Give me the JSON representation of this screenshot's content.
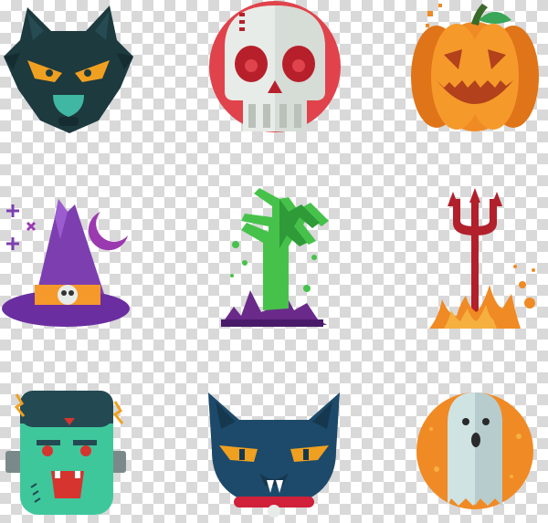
{
  "background": {
    "type": "transparency-checkerboard",
    "light": "#ffffff",
    "dark": "#d9d9d9"
  },
  "icons": [
    {
      "name": "werewolf-icon",
      "row": 1,
      "col": 1,
      "colors": [
        "#1d3a3f",
        "#f0a020",
        "#3fb7a2"
      ]
    },
    {
      "name": "skull-icon",
      "row": 1,
      "col": 2,
      "colors": [
        "#e0434b",
        "#e8ece8",
        "#b7202b"
      ]
    },
    {
      "name": "jack-o-lantern-icon",
      "row": 1,
      "col": 3,
      "colors": [
        "#f08a24",
        "#b2411c",
        "#3aa657"
      ]
    },
    {
      "name": "witch-hat-icon",
      "row": 2,
      "col": 1,
      "colors": [
        "#7d3fb0",
        "#f59a2a",
        "#9b3ab0"
      ]
    },
    {
      "name": "zombie-hand-icon",
      "row": 2,
      "col": 2,
      "colors": [
        "#46c24a",
        "#6a2a8a"
      ]
    },
    {
      "name": "pitchfork-icon",
      "row": 2,
      "col": 3,
      "colors": [
        "#b2202b",
        "#f08a24"
      ]
    },
    {
      "name": "frankenstein-icon",
      "row": 3,
      "col": 1,
      "colors": [
        "#3fc79c",
        "#234a52",
        "#d6342f"
      ]
    },
    {
      "name": "black-cat-icon",
      "row": 3,
      "col": 2,
      "colors": [
        "#1d4a6a",
        "#f0a020",
        "#d0203a"
      ]
    },
    {
      "name": "ghost-icon",
      "row": 3,
      "col": 3,
      "colors": [
        "#f08a24",
        "#cfe3e3"
      ]
    }
  ]
}
